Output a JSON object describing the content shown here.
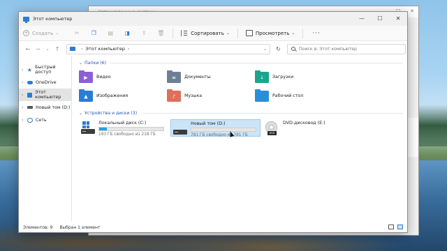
{
  "background_window": {
    "title": "Установленные системы"
  },
  "window": {
    "title": "Этот компьютер",
    "controls": {
      "minimize": "—",
      "maximize": "☐",
      "close": "✕"
    }
  },
  "toolbar": {
    "create_label": "Создать",
    "sort_label": "Сортировать",
    "view_label": "Просмотреть",
    "more": "···"
  },
  "address": {
    "path": "Этот компьютер",
    "separator": "›",
    "search_placeholder": "Поиск в: Этот компьютер"
  },
  "sidebar": {
    "items": [
      {
        "label": "Быстрый доступ",
        "icon": "star-icon",
        "selected": false
      },
      {
        "label": "OneDrive",
        "icon": "cloud-icon",
        "selected": false
      },
      {
        "label": "Этот компьютер",
        "icon": "computer-icon",
        "selected": true
      },
      {
        "label": "Новый том (D:)",
        "icon": "drive-icon",
        "selected": false
      },
      {
        "label": "Сеть",
        "icon": "network-icon",
        "selected": false
      }
    ]
  },
  "folders_group": {
    "label": "Папки (6)"
  },
  "folders": [
    {
      "label": "Видео",
      "icon": "video-folder-icon",
      "color": "#8b5fd6",
      "mark": "▶"
    },
    {
      "label": "Документы",
      "icon": "documents-folder-icon",
      "color": "#6e7f95",
      "mark": "≡"
    },
    {
      "label": "Загрузки",
      "icon": "downloads-folder-icon",
      "color": "#1aa58c",
      "mark": "↓"
    },
    {
      "label": "Изображения",
      "icon": "pictures-folder-icon",
      "color": "#2b7cd3",
      "mark": "▲"
    },
    {
      "label": "Музыка",
      "icon": "music-folder-icon",
      "color": "#e06f5a",
      "mark": "♪"
    },
    {
      "label": "Рабочий стол",
      "icon": "desktop-folder-icon",
      "color": "#2b8fd8",
      "mark": ""
    }
  ],
  "drives_group": {
    "label": "Устройства и диски (3)"
  },
  "drives": [
    {
      "name": "Локальный диск (C:)",
      "free": "193 ГБ свободно из 218 ГБ",
      "used_fraction": 0.115,
      "selected": false,
      "type": "system"
    },
    {
      "name": "Новый том (D:)",
      "free": "781 ГБ свободно из 781 ГБ",
      "used_fraction": 0.0,
      "selected": true,
      "type": "hdd"
    },
    {
      "name": "DVD-дисковод (E:)",
      "free": "",
      "used_fraction": null,
      "selected": false,
      "type": "dvd",
      "badge": "DVD"
    }
  ],
  "status": {
    "count": "Элементов: 9",
    "selected": "Выбран 1 элемент"
  }
}
